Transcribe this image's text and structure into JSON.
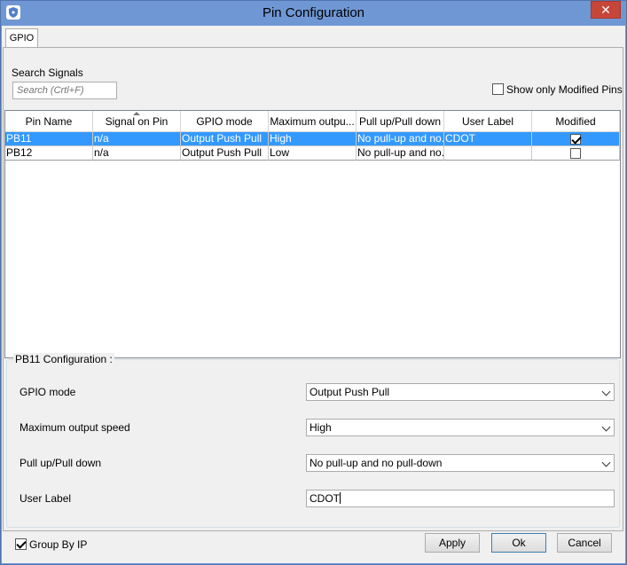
{
  "window": {
    "title": "Pin Configuration",
    "close_glyph": "✕"
  },
  "tabs": [
    {
      "label": "GPIO"
    }
  ],
  "search": {
    "label": "Search Signals",
    "placeholder": "Search (Crtl+F)"
  },
  "show_modified": {
    "label": "Show only Modified Pins",
    "checked": false
  },
  "table": {
    "columns": [
      "Pin Name",
      "Signal on Pin",
      "GPIO mode",
      "Maximum outpu...",
      "Pull up/Pull down",
      "User Label",
      "Modified"
    ],
    "sorted_column": "Signal on Pin",
    "rows": [
      {
        "pin": "PB11",
        "signal": "n/a",
        "mode": "Output Push Pull",
        "speed": "High",
        "pull": "No pull-up and no...",
        "label": "CDOT",
        "modified": true,
        "selected": true
      },
      {
        "pin": "PB12",
        "signal": "n/a",
        "mode": "Output Push Pull",
        "speed": "Low",
        "pull": "No pull-up and no...",
        "label": "",
        "modified": false,
        "selected": false
      }
    ]
  },
  "config": {
    "title": "PB11 Configuration :",
    "gpio_mode": {
      "label": "GPIO mode",
      "value": "Output Push Pull"
    },
    "max_speed": {
      "label": "Maximum output speed",
      "value": "High"
    },
    "pull": {
      "label": "Pull up/Pull down",
      "value": "No pull-up and no pull-down"
    },
    "user_label": {
      "label": "User Label",
      "value": "CDOT"
    }
  },
  "footer": {
    "group_by_ip": {
      "label": "Group By IP",
      "checked": true
    },
    "apply": "Apply",
    "ok": "Ok",
    "cancel": "Cancel"
  },
  "colors": {
    "titlebar": "#6f97d4",
    "selection": "#3399ff",
    "close": "#c7463a"
  }
}
